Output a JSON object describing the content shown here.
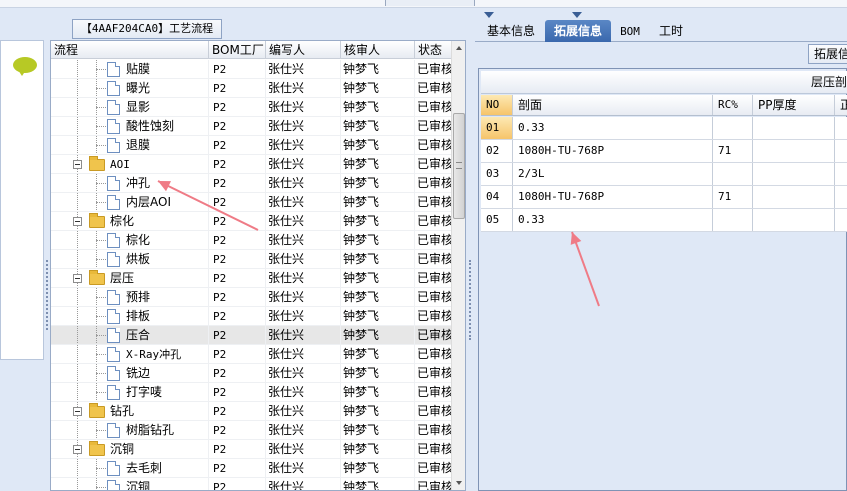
{
  "process_panel": {
    "title": "【4AAF204CA0】工艺流程",
    "columns": [
      "流程",
      "BOM工厂",
      "编写人",
      "核审人",
      "状态"
    ],
    "rows": [
      {
        "name": "贴膜",
        "bom": "P2",
        "writer": "张仕兴",
        "reviewer": "钟梦飞",
        "status": "已审核",
        "type": "leaf",
        "depth": 2
      },
      {
        "name": "曝光",
        "bom": "P2",
        "writer": "张仕兴",
        "reviewer": "钟梦飞",
        "status": "已审核",
        "type": "leaf",
        "depth": 2
      },
      {
        "name": "显影",
        "bom": "P2",
        "writer": "张仕兴",
        "reviewer": "钟梦飞",
        "status": "已审核",
        "type": "leaf",
        "depth": 2
      },
      {
        "name": "酸性蚀刻",
        "bom": "P2",
        "writer": "张仕兴",
        "reviewer": "钟梦飞",
        "status": "已审核",
        "type": "leaf",
        "depth": 2
      },
      {
        "name": "退膜",
        "bom": "P2",
        "writer": "张仕兴",
        "reviewer": "钟梦飞",
        "status": "已审核",
        "type": "leaf",
        "depth": 2
      },
      {
        "name": "AOI",
        "bom": "P2",
        "writer": "张仕兴",
        "reviewer": "钟梦飞",
        "status": "已审核",
        "type": "folder",
        "depth": 1
      },
      {
        "name": "冲孔",
        "bom": "P2",
        "writer": "张仕兴",
        "reviewer": "钟梦飞",
        "status": "已审核",
        "type": "leaf",
        "depth": 2
      },
      {
        "name": "内层AOI",
        "bom": "P2",
        "writer": "张仕兴",
        "reviewer": "钟梦飞",
        "status": "已审核",
        "type": "leaf",
        "depth": 2
      },
      {
        "name": "棕化",
        "bom": "P2",
        "writer": "张仕兴",
        "reviewer": "钟梦飞",
        "status": "已审核",
        "type": "folder",
        "depth": 1
      },
      {
        "name": "棕化",
        "bom": "P2",
        "writer": "张仕兴",
        "reviewer": "钟梦飞",
        "status": "已审核",
        "type": "leaf",
        "depth": 2
      },
      {
        "name": "烘板",
        "bom": "P2",
        "writer": "张仕兴",
        "reviewer": "钟梦飞",
        "status": "已审核",
        "type": "leaf",
        "depth": 2
      },
      {
        "name": "层压",
        "bom": "P2",
        "writer": "张仕兴",
        "reviewer": "钟梦飞",
        "status": "已审核",
        "type": "folder",
        "depth": 1
      },
      {
        "name": "预排",
        "bom": "P2",
        "writer": "张仕兴",
        "reviewer": "钟梦飞",
        "status": "已审核",
        "type": "leaf",
        "depth": 2
      },
      {
        "name": "排板",
        "bom": "P2",
        "writer": "张仕兴",
        "reviewer": "钟梦飞",
        "status": "已审核",
        "type": "leaf",
        "depth": 2
      },
      {
        "name": "压合",
        "bom": "P2",
        "writer": "张仕兴",
        "reviewer": "钟梦飞",
        "status": "已审核",
        "type": "leaf",
        "depth": 2,
        "selected": true
      },
      {
        "name": "X-Ray冲孔",
        "bom": "P2",
        "writer": "张仕兴",
        "reviewer": "钟梦飞",
        "status": "已审核",
        "type": "leaf",
        "depth": 2
      },
      {
        "name": "铣边",
        "bom": "P2",
        "writer": "张仕兴",
        "reviewer": "钟梦飞",
        "status": "已审核",
        "type": "leaf",
        "depth": 2
      },
      {
        "name": "打字唛",
        "bom": "P2",
        "writer": "张仕兴",
        "reviewer": "钟梦飞",
        "status": "已审核",
        "type": "leaf",
        "depth": 2
      },
      {
        "name": "钻孔",
        "bom": "P2",
        "writer": "张仕兴",
        "reviewer": "钟梦飞",
        "status": "已审核",
        "type": "folder",
        "depth": 1
      },
      {
        "name": "树脂钻孔",
        "bom": "P2",
        "writer": "张仕兴",
        "reviewer": "钟梦飞",
        "status": "已审核",
        "type": "leaf",
        "depth": 2
      },
      {
        "name": "沉铜",
        "bom": "P2",
        "writer": "张仕兴",
        "reviewer": "钟梦飞",
        "status": "已审核",
        "type": "folder",
        "depth": 1
      },
      {
        "name": "去毛刺",
        "bom": "P2",
        "writer": "张仕兴",
        "reviewer": "钟梦飞",
        "status": "已审核",
        "type": "leaf",
        "depth": 2
      },
      {
        "name": "沉铜",
        "bom": "P2",
        "writer": "张仕兴",
        "reviewer": "钟梦飞",
        "status": "已审核",
        "type": "leaf",
        "depth": 2
      }
    ]
  },
  "tabs": [
    {
      "label": "基本信息",
      "active": false
    },
    {
      "label": "拓展信息",
      "active": true
    },
    {
      "label": "BOM",
      "active": false
    },
    {
      "label": "工时",
      "active": false
    }
  ],
  "extended": {
    "button_label": "拓展信息",
    "grid_caption": "层压剖",
    "columns": [
      "NO",
      "剖面",
      "RC%",
      "PP厚度",
      "正"
    ],
    "rows": [
      {
        "no": "01",
        "section": "0.33",
        "rc": "",
        "pp": ""
      },
      {
        "no": "02",
        "section": "1080H-TU-768P",
        "rc": "71",
        "pp": ""
      },
      {
        "no": "03",
        "section": "2/3L",
        "rc": "",
        "pp": ""
      },
      {
        "no": "04",
        "section": "1080H-TU-768P",
        "rc": "71",
        "pp": ""
      },
      {
        "no": "05",
        "section": "0.33",
        "rc": "",
        "pp": ""
      }
    ]
  },
  "colors": {
    "panel_bg": "#dfe8f6",
    "active_tab": "#3a68ad",
    "annotation_arrow": "#ef7b86",
    "selected_row": "#e7e7e7"
  }
}
